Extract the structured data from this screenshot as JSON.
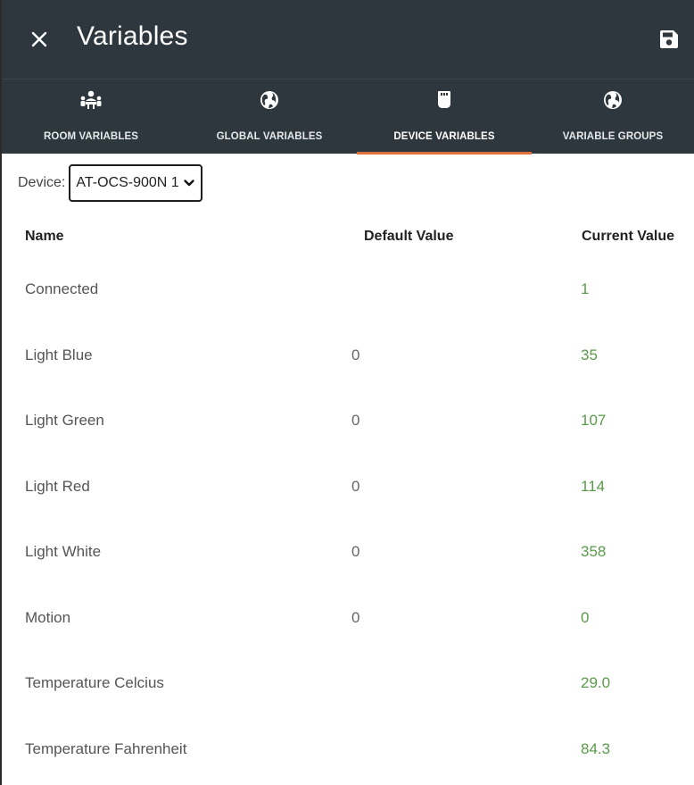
{
  "header": {
    "title": "Variables",
    "close_icon": "close-icon",
    "save_icon": "save-icon"
  },
  "tabs": [
    {
      "label": "ROOM VARIABLES",
      "icon": "group-icon",
      "active": false
    },
    {
      "label": "GLOBAL VARIABLES",
      "icon": "globe-icon",
      "active": false
    },
    {
      "label": "DEVICE VARIABLES",
      "icon": "device-icon",
      "active": true
    },
    {
      "label": "VARIABLE GROUPS",
      "icon": "globe-icon",
      "active": false
    }
  ],
  "device": {
    "label": "Device:",
    "selected": "AT-OCS-900N 1"
  },
  "table": {
    "headers": {
      "name": "Name",
      "default": "Default Value",
      "current": "Current Value"
    },
    "rows": [
      {
        "name": "Connected",
        "default": "",
        "current": "1"
      },
      {
        "name": "Light Blue",
        "default": "0",
        "current": "35"
      },
      {
        "name": "Light Green",
        "default": "0",
        "current": "107"
      },
      {
        "name": "Light Red",
        "default": "0",
        "current": "114"
      },
      {
        "name": "Light White",
        "default": "0",
        "current": "358"
      },
      {
        "name": "Motion",
        "default": "0",
        "current": "0"
      },
      {
        "name": "Temperature Celcius",
        "default": "",
        "current": "29.0"
      },
      {
        "name": "Temperature Fahrenheit",
        "default": "",
        "current": "84.3"
      }
    ]
  },
  "colors": {
    "header_bg": "#2e373d",
    "accent": "#e0703e",
    "current_value": "#5a9a4a"
  }
}
